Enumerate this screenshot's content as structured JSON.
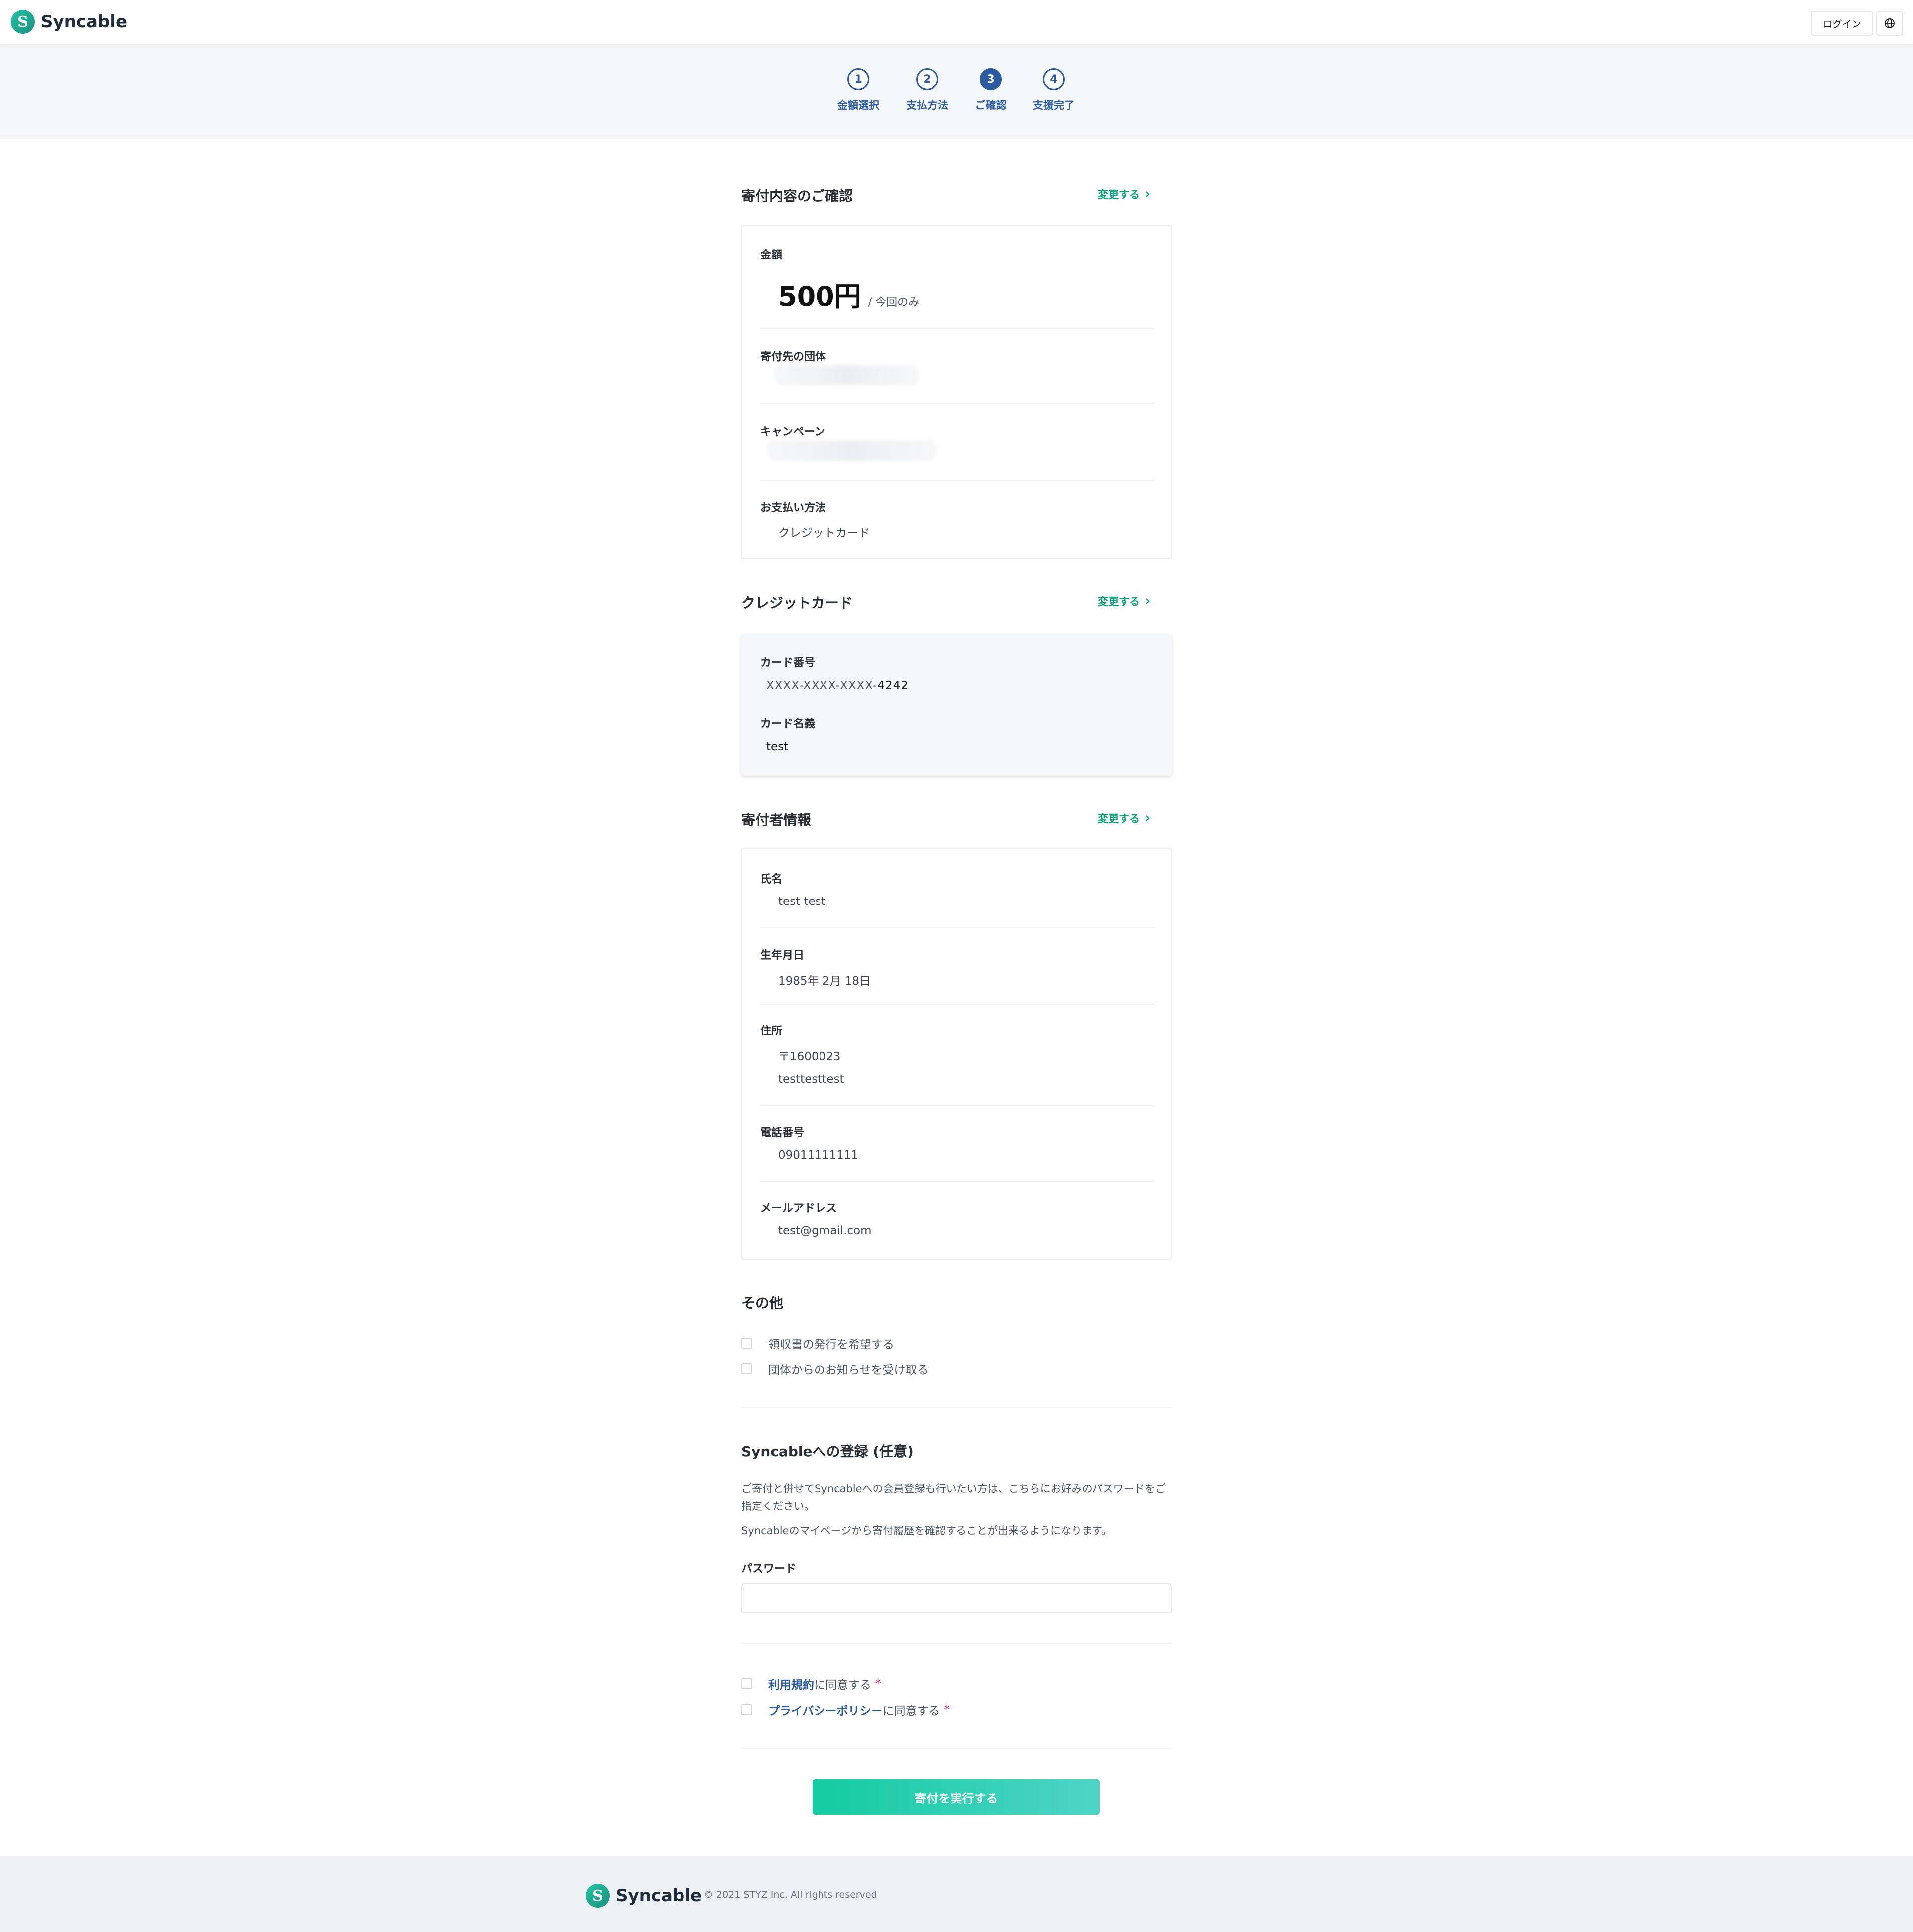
{
  "header": {
    "brand": "Syncable",
    "logo_letter": "S",
    "login_label": "ログイン"
  },
  "stepper": {
    "steps": [
      {
        "num": "1",
        "label": "金額選択"
      },
      {
        "num": "2",
        "label": "支払方法"
      },
      {
        "num": "3",
        "label": "ご確認"
      },
      {
        "num": "4",
        "label": "支援完了"
      }
    ],
    "active": "3"
  },
  "donation": {
    "title": "寄付内容のご確認",
    "change": "変更する",
    "amount_label": "金額",
    "amount_value": "500円",
    "amount_suffix": "/ 今回のみ",
    "org_label": "寄付先の団体",
    "campaign_label": "キャンペーン",
    "payment_label": "お支払い方法",
    "payment_value": "クレジットカード"
  },
  "card": {
    "title": "クレジットカード",
    "change": "変更する",
    "number_label": "カード番号",
    "number_masked": "XXXX-XXXX-XXXX-",
    "number_last4": "4242",
    "holder_label": "カード名義",
    "holder_value": "test"
  },
  "donor": {
    "title": "寄付者情報",
    "change": "変更する",
    "name_label": "氏名",
    "name_value": "test test",
    "birth_label": "生年月日",
    "birth_value": "1985年 2月 18日",
    "address_label": "住所",
    "postal": "〒1600023",
    "address_value": "testtesttest",
    "phone_label": "電話番号",
    "phone_value": "09011111111",
    "email_label": "メールアドレス",
    "email_value": "test@gmail.com"
  },
  "other": {
    "title": "その他",
    "receipt": "領収書の発行を希望する",
    "news": "団体からのお知らせを受け取る"
  },
  "register": {
    "title": "Syncableへの登録 (任意)",
    "desc1": "ご寄付と併せてSyncableへの会員登録も行いたい方は、こちらにお好みのパスワードをご指定ください。",
    "desc2": "Syncableのマイページから寄付履歴を確認することが出来るようになります。",
    "password_label": "パスワード"
  },
  "agree": {
    "terms_link": "利用規約",
    "terms_suffix": "に同意する",
    "privacy_link": "プライバシーポリシー",
    "privacy_suffix": "に同意する",
    "required_mark": "*"
  },
  "submit_label": "寄付を実行する",
  "footer": {
    "brand": "Syncable",
    "copyright": "© 2021 STYZ Inc. All rights reserved"
  },
  "colors": {
    "accent": "#13cba1",
    "primary": "#2b5aa0",
    "link": "#0aa07a"
  }
}
